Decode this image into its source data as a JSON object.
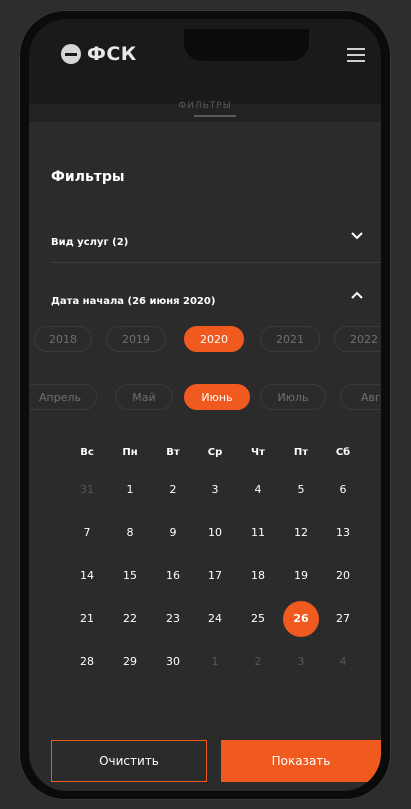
{
  "header": {
    "logo_text": "ФСК",
    "logo_icon": "fsk-logo-mark",
    "menu_icon": "hamburger-icon",
    "faded_tab": "ФИЛЬТРЫ"
  },
  "filters": {
    "title": "Фильтры",
    "service_type_label": "Вид услуг (2)",
    "start_date_label": "Дата начала (26 июня 2020)"
  },
  "years": [
    "2018",
    "2019",
    "2020",
    "2021",
    "2022"
  ],
  "selected_year": "2020",
  "months": [
    "Апрель",
    "Май",
    "Июнь",
    "Июль",
    "Авгус"
  ],
  "selected_month": "Июнь",
  "calendar": {
    "weekdays": [
      "Вс",
      "Пн",
      "Вт",
      "Ср",
      "Чт",
      "Пт",
      "Сб"
    ],
    "weeks": [
      [
        "31",
        "1",
        "2",
        "3",
        "4",
        "5",
        "6"
      ],
      [
        "7",
        "8",
        "9",
        "10",
        "11",
        "12",
        "13"
      ],
      [
        "14",
        "15",
        "16",
        "17",
        "18",
        "19",
        "20"
      ],
      [
        "21",
        "22",
        "23",
        "24",
        "25",
        "26",
        "27"
      ],
      [
        "28",
        "29",
        "30",
        "1",
        "2",
        "3",
        "4"
      ]
    ],
    "selected_day": "26"
  },
  "actions": {
    "clear_label": "Очистить",
    "show_label": "Показать"
  },
  "colors": {
    "accent": "#f05a1e",
    "background": "#2b2b2b",
    "topbar": "#1a1a1a"
  }
}
